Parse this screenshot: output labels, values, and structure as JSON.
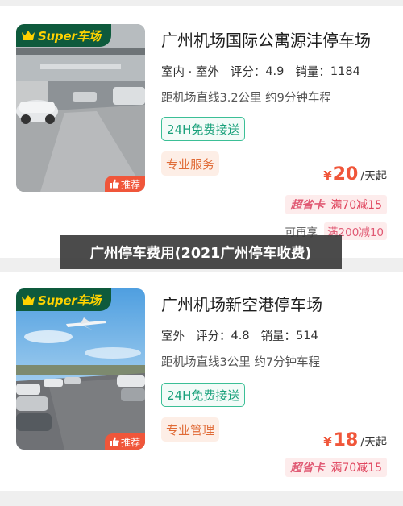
{
  "listings": [
    {
      "brand": "Super车场",
      "recommend": "推荐",
      "name": "广州机场国际公寓源沣停车场",
      "type": "室内 · 室外",
      "rating_label": "评分：",
      "rating": "4.9",
      "sales_label": "销量：",
      "sales": "1184",
      "distance": "距机场直线3.2公里 约9分钟车程",
      "shuttle": "24H免费接送",
      "service": "专业服务",
      "currency": "¥",
      "price": "20",
      "price_unit": "/天起",
      "promo_label": "超省卡",
      "promo_value": "满70减15",
      "again_label": "可再享",
      "again_value": "满200减10"
    },
    {
      "brand": "Super车场",
      "recommend": "推荐",
      "name": "广州机场新空港停车场",
      "type": "室外",
      "rating_label": "评分：",
      "rating": "4.8",
      "sales_label": "销量：",
      "sales": "514",
      "distance": "距机场直线3公里 约7分钟车程",
      "shuttle": "24H免费接送",
      "service": "专业管理",
      "currency": "¥",
      "price": "18",
      "price_unit": "/天起",
      "promo_label": "超省卡",
      "promo_value": "满70减15"
    }
  ],
  "banner": "广州停车费用(2021广州停车收费)",
  "colors": {
    "accent": "#f0563a",
    "brand_green": "#0e5a3c",
    "brand_yellow": "#ffd200",
    "teal": "#2ec7a0"
  },
  "icons": [
    "crown-icon",
    "thumbs-up-icon"
  ]
}
